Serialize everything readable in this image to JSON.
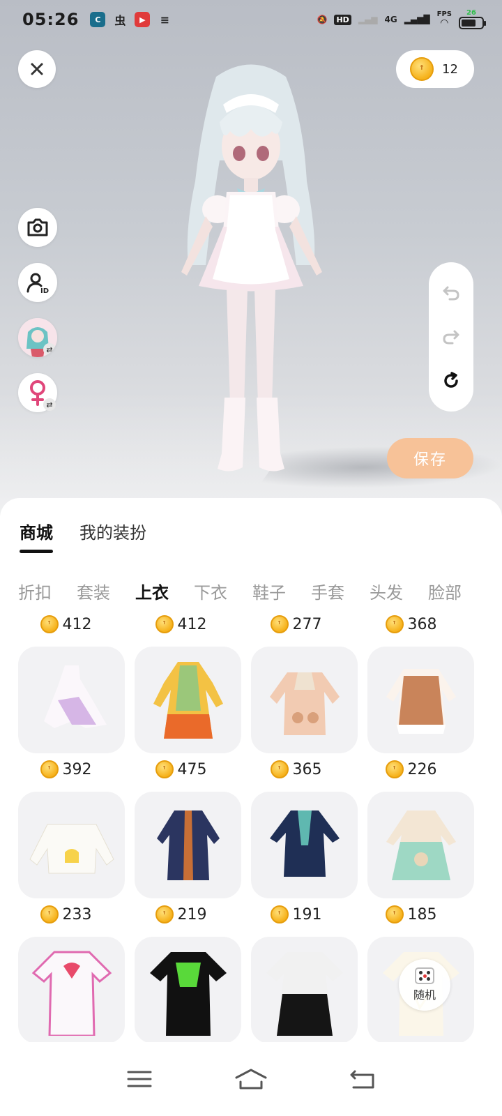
{
  "status_bar": {
    "time": "05:26",
    "fps_label": "FPS",
    "fps_value": "26",
    "network": "4G",
    "hd_label": "HD"
  },
  "header": {
    "coin_balance": "12"
  },
  "actions": {
    "save_label": "保存",
    "random_label": "随机"
  },
  "tabs": {
    "main": [
      {
        "label": "商城",
        "active": true
      },
      {
        "label": "我的装扮",
        "active": false
      }
    ],
    "categories": [
      {
        "label": "折扣",
        "active": false
      },
      {
        "label": "套装",
        "active": false
      },
      {
        "label": "上衣",
        "active": true
      },
      {
        "label": "下衣",
        "active": false
      },
      {
        "label": "鞋子",
        "active": false
      },
      {
        "label": "手套",
        "active": false
      },
      {
        "label": "头发",
        "active": false
      },
      {
        "label": "脸部",
        "active": false
      }
    ]
  },
  "items": {
    "top_prices": [
      "412",
      "412",
      "277",
      "368"
    ],
    "row1": [
      {
        "price": "392",
        "icon": "white-lace-dress"
      },
      {
        "price": "475",
        "icon": "green-orange-robe"
      },
      {
        "price": "365",
        "icon": "peach-bear-hoodie"
      },
      {
        "price": "226",
        "icon": "brown-frill-coat"
      }
    ],
    "row2": [
      {
        "price": "233",
        "icon": "duck-sweater"
      },
      {
        "price": "219",
        "icon": "navy-jacket"
      },
      {
        "price": "191",
        "icon": "teal-navy-jacket"
      },
      {
        "price": "185",
        "icon": "mint-bear-dress"
      }
    ],
    "row3": [
      {
        "icon": "pink-heart-tee"
      },
      {
        "icon": "black-graphic-tee"
      },
      {
        "icon": "black-white-dress"
      },
      {
        "icon": "cream-tee"
      }
    ]
  },
  "colors": {
    "save_button": "#f7c298",
    "coin_gold": "#f6b21c",
    "active_text": "#111111",
    "inactive_text": "#999999"
  }
}
